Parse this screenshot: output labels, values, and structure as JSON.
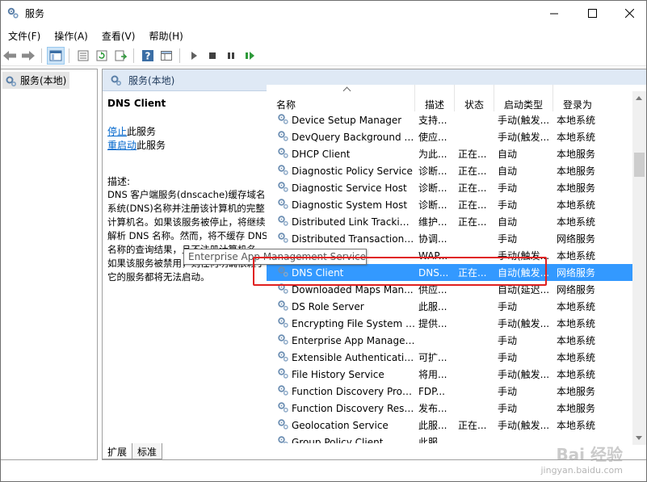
{
  "window": {
    "title": "服务"
  },
  "menu": [
    "文件(F)",
    "操作(A)",
    "查看(V)",
    "帮助(H)"
  ],
  "toolbar": [
    {
      "icon": "back-arrow-icon"
    },
    {
      "icon": "forward-arrow-icon"
    },
    {
      "icon": "show-console-tree-icon"
    },
    {
      "icon": "export-list-icon"
    },
    {
      "icon": "refresh-icon"
    },
    {
      "icon": "properties-icon"
    },
    {
      "icon": "help-icon"
    },
    {
      "icon": "console-view-icon"
    },
    {
      "icon": "start-service-icon"
    },
    {
      "icon": "stop-service-icon"
    },
    {
      "icon": "pause-service-icon"
    },
    {
      "icon": "restart-service-icon"
    }
  ],
  "tree": {
    "item": "服务(本地)"
  },
  "pane": {
    "header": "服务(本地)"
  },
  "detail": {
    "name": "DNS Client",
    "stop_link": "停止",
    "stop_suffix": "此服务",
    "restart_link": "重启动",
    "restart_suffix": "此服务",
    "desc_label": "描述:",
    "description": "DNS 客户端服务(dnscache)缓存域名系统(DNS)名称并注册该计算机的完整计算机名。如果该服务被停止，将继续解析 DNS 名称。然而，将不缓存 DNS 名称的查询结果，且不注册计算机名。如果该服务被禁用，则任何明确依赖于它的服务都将无法启动。"
  },
  "columns": {
    "name": "名称",
    "desc": "描述",
    "status": "状态",
    "startup": "启动类型",
    "logon": "登录为"
  },
  "rows": [
    {
      "name": "Device Setup Manager",
      "desc": "支持...",
      "status": "",
      "startup": "手动(触发...",
      "logon": "本地系统"
    },
    {
      "name": "DevQuery Background D...",
      "desc": "使应...",
      "status": "",
      "startup": "手动(触发...",
      "logon": "本地系统"
    },
    {
      "name": "DHCP Client",
      "desc": "为此...",
      "status": "正在...",
      "startup": "自动",
      "logon": "本地服务"
    },
    {
      "name": "Diagnostic Policy Service",
      "desc": "诊断...",
      "status": "正在...",
      "startup": "自动",
      "logon": "本地服务"
    },
    {
      "name": "Diagnostic Service Host",
      "desc": "诊断...",
      "status": "正在...",
      "startup": "手动",
      "logon": "本地服务"
    },
    {
      "name": "Diagnostic System Host",
      "desc": "诊断...",
      "status": "正在...",
      "startup": "手动",
      "logon": "本地系统"
    },
    {
      "name": "Distributed Link Tracking...",
      "desc": "维护...",
      "status": "正在...",
      "startup": "自动",
      "logon": "本地系统"
    },
    {
      "name": "Distributed Transaction C...",
      "desc": "协调...",
      "status": "",
      "startup": "手动",
      "logon": "网络服务"
    },
    {
      "name": "dmwappushsvc",
      "desc": "WAP...",
      "status": "",
      "startup": "手动(触发...",
      "logon": "本地系统"
    },
    {
      "name": "DNS Client",
      "desc": "DNS...",
      "status": "正在...",
      "startup": "自动(触发...",
      "logon": "网络服务",
      "selected": true
    },
    {
      "name": "Downloaded Maps Man...",
      "desc": "供应...",
      "status": "",
      "startup": "自动(延迟...",
      "logon": "网络服务"
    },
    {
      "name": "DS Role Server",
      "desc": "此服...",
      "status": "",
      "startup": "手动",
      "logon": "本地系统"
    },
    {
      "name": "Encrypting File System (E...",
      "desc": "提供...",
      "status": "",
      "startup": "手动(触发...",
      "logon": "本地系统"
    },
    {
      "name": "Enterprise App Management Service",
      "desc": "",
      "status": "",
      "startup": "手动",
      "logon": "本地系统"
    },
    {
      "name": "Extensible Authentication...",
      "desc": "可扩...",
      "status": "",
      "startup": "手动",
      "logon": "本地系统"
    },
    {
      "name": "File History Service",
      "desc": "将用...",
      "status": "",
      "startup": "手动(触发...",
      "logon": "本地系统"
    },
    {
      "name": "Function Discovery Provi...",
      "desc": "FDP...",
      "status": "",
      "startup": "手动",
      "logon": "本地服务"
    },
    {
      "name": "Function Discovery Reso...",
      "desc": "发布...",
      "status": "",
      "startup": "手动",
      "logon": "本地服务"
    },
    {
      "name": "Geolocation Service",
      "desc": "此服...",
      "status": "正在...",
      "startup": "手动(触发...",
      "logon": "本地系统"
    },
    {
      "name": "Group Policy Client",
      "desc": "此服...",
      "status": "",
      "startup": "",
      "logon": ""
    }
  ],
  "tooltip": "Enterprise App Management Service",
  "tabs": [
    "扩展",
    "标准"
  ],
  "watermark": {
    "line1": "Bai 经验",
    "line2": "jingyan.baidu.com"
  },
  "colors": {
    "selection": "#3399ff",
    "highlight": "#e02020",
    "pane_header": "#dfe9f5",
    "link": "#0066cc"
  }
}
